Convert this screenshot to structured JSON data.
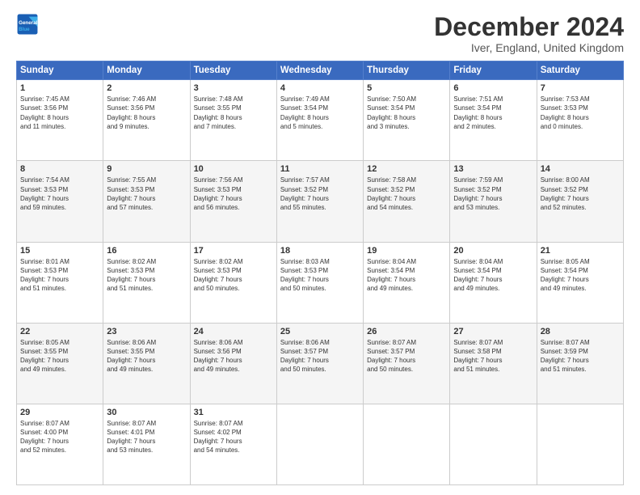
{
  "header": {
    "logo_line1": "General",
    "logo_line2": "Blue",
    "title": "December 2024",
    "subtitle": "Iver, England, United Kingdom"
  },
  "days_of_week": [
    "Sunday",
    "Monday",
    "Tuesday",
    "Wednesday",
    "Thursday",
    "Friday",
    "Saturday"
  ],
  "weeks": [
    [
      {
        "day": "1",
        "info": "Sunrise: 7:45 AM\nSunset: 3:56 PM\nDaylight: 8 hours\nand 11 minutes."
      },
      {
        "day": "2",
        "info": "Sunrise: 7:46 AM\nSunset: 3:56 PM\nDaylight: 8 hours\nand 9 minutes."
      },
      {
        "day": "3",
        "info": "Sunrise: 7:48 AM\nSunset: 3:55 PM\nDaylight: 8 hours\nand 7 minutes."
      },
      {
        "day": "4",
        "info": "Sunrise: 7:49 AM\nSunset: 3:54 PM\nDaylight: 8 hours\nand 5 minutes."
      },
      {
        "day": "5",
        "info": "Sunrise: 7:50 AM\nSunset: 3:54 PM\nDaylight: 8 hours\nand 3 minutes."
      },
      {
        "day": "6",
        "info": "Sunrise: 7:51 AM\nSunset: 3:54 PM\nDaylight: 8 hours\nand 2 minutes."
      },
      {
        "day": "7",
        "info": "Sunrise: 7:53 AM\nSunset: 3:53 PM\nDaylight: 8 hours\nand 0 minutes."
      }
    ],
    [
      {
        "day": "8",
        "info": "Sunrise: 7:54 AM\nSunset: 3:53 PM\nDaylight: 7 hours\nand 59 minutes."
      },
      {
        "day": "9",
        "info": "Sunrise: 7:55 AM\nSunset: 3:53 PM\nDaylight: 7 hours\nand 57 minutes."
      },
      {
        "day": "10",
        "info": "Sunrise: 7:56 AM\nSunset: 3:53 PM\nDaylight: 7 hours\nand 56 minutes."
      },
      {
        "day": "11",
        "info": "Sunrise: 7:57 AM\nSunset: 3:52 PM\nDaylight: 7 hours\nand 55 minutes."
      },
      {
        "day": "12",
        "info": "Sunrise: 7:58 AM\nSunset: 3:52 PM\nDaylight: 7 hours\nand 54 minutes."
      },
      {
        "day": "13",
        "info": "Sunrise: 7:59 AM\nSunset: 3:52 PM\nDaylight: 7 hours\nand 53 minutes."
      },
      {
        "day": "14",
        "info": "Sunrise: 8:00 AM\nSunset: 3:52 PM\nDaylight: 7 hours\nand 52 minutes."
      }
    ],
    [
      {
        "day": "15",
        "info": "Sunrise: 8:01 AM\nSunset: 3:53 PM\nDaylight: 7 hours\nand 51 minutes."
      },
      {
        "day": "16",
        "info": "Sunrise: 8:02 AM\nSunset: 3:53 PM\nDaylight: 7 hours\nand 51 minutes."
      },
      {
        "day": "17",
        "info": "Sunrise: 8:02 AM\nSunset: 3:53 PM\nDaylight: 7 hours\nand 50 minutes."
      },
      {
        "day": "18",
        "info": "Sunrise: 8:03 AM\nSunset: 3:53 PM\nDaylight: 7 hours\nand 50 minutes."
      },
      {
        "day": "19",
        "info": "Sunrise: 8:04 AM\nSunset: 3:54 PM\nDaylight: 7 hours\nand 49 minutes."
      },
      {
        "day": "20",
        "info": "Sunrise: 8:04 AM\nSunset: 3:54 PM\nDaylight: 7 hours\nand 49 minutes."
      },
      {
        "day": "21",
        "info": "Sunrise: 8:05 AM\nSunset: 3:54 PM\nDaylight: 7 hours\nand 49 minutes."
      }
    ],
    [
      {
        "day": "22",
        "info": "Sunrise: 8:05 AM\nSunset: 3:55 PM\nDaylight: 7 hours\nand 49 minutes."
      },
      {
        "day": "23",
        "info": "Sunrise: 8:06 AM\nSunset: 3:55 PM\nDaylight: 7 hours\nand 49 minutes."
      },
      {
        "day": "24",
        "info": "Sunrise: 8:06 AM\nSunset: 3:56 PM\nDaylight: 7 hours\nand 49 minutes."
      },
      {
        "day": "25",
        "info": "Sunrise: 8:06 AM\nSunset: 3:57 PM\nDaylight: 7 hours\nand 50 minutes."
      },
      {
        "day": "26",
        "info": "Sunrise: 8:07 AM\nSunset: 3:57 PM\nDaylight: 7 hours\nand 50 minutes."
      },
      {
        "day": "27",
        "info": "Sunrise: 8:07 AM\nSunset: 3:58 PM\nDaylight: 7 hours\nand 51 minutes."
      },
      {
        "day": "28",
        "info": "Sunrise: 8:07 AM\nSunset: 3:59 PM\nDaylight: 7 hours\nand 51 minutes."
      }
    ],
    [
      {
        "day": "29",
        "info": "Sunrise: 8:07 AM\nSunset: 4:00 PM\nDaylight: 7 hours\nand 52 minutes."
      },
      {
        "day": "30",
        "info": "Sunrise: 8:07 AM\nSunset: 4:01 PM\nDaylight: 7 hours\nand 53 minutes."
      },
      {
        "day": "31",
        "info": "Sunrise: 8:07 AM\nSunset: 4:02 PM\nDaylight: 7 hours\nand 54 minutes."
      },
      {
        "day": "",
        "info": ""
      },
      {
        "day": "",
        "info": ""
      },
      {
        "day": "",
        "info": ""
      },
      {
        "day": "",
        "info": ""
      }
    ]
  ]
}
